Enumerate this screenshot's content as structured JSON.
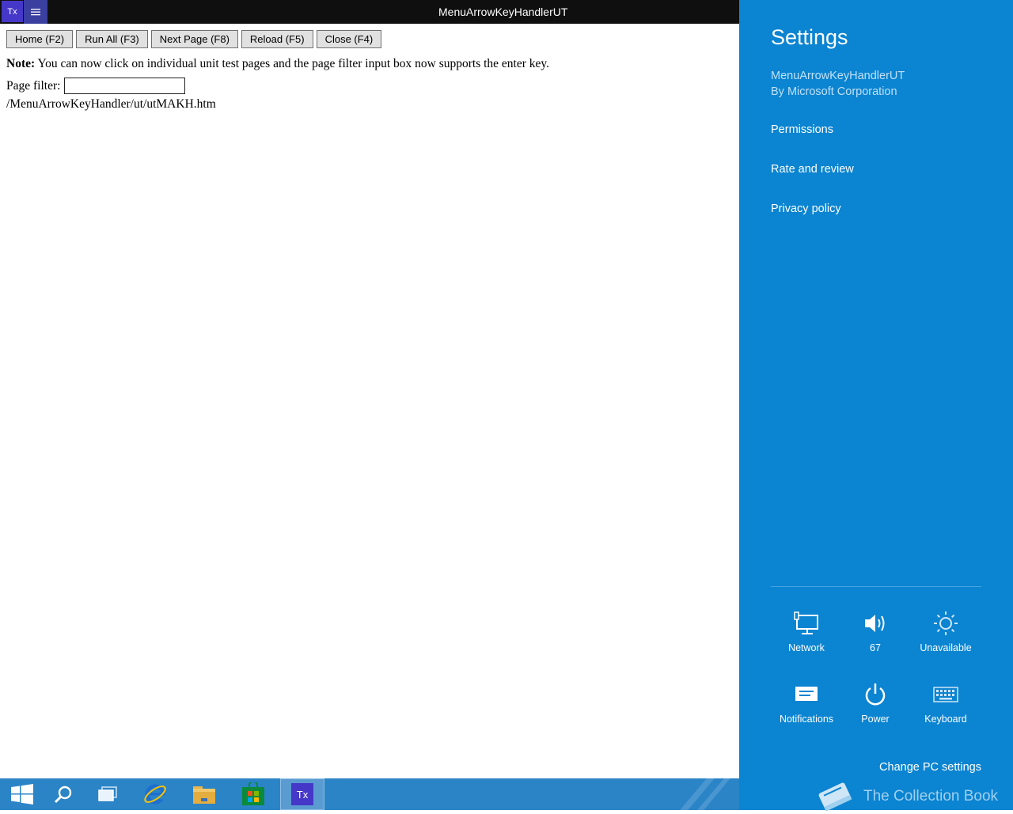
{
  "titlebar": {
    "app_icon_text": "Tx",
    "title": "MenuArrowKeyHandlerUT"
  },
  "toolbar": {
    "buttons": [
      {
        "label": "Home (F2)"
      },
      {
        "label": "Run All (F3)"
      },
      {
        "label": "Next Page (F8)"
      },
      {
        "label": "Reload (F5)"
      },
      {
        "label": "Close (F4)"
      }
    ]
  },
  "note": {
    "label": "Note:",
    "text": " You can now click on individual unit test pages and the page filter input box now supports the enter key."
  },
  "filter": {
    "label": "Page filter:",
    "value": ""
  },
  "test_page_path": "/MenuArrowKeyHandler/ut/utMAKH.htm",
  "taskbar": {
    "items": [
      "start-icon",
      "search-icon",
      "task-view-icon",
      "internet-explorer-icon",
      "file-explorer-icon",
      "store-icon",
      "tx-app-icon"
    ],
    "active_app_text": "Tx"
  },
  "settings": {
    "title": "Settings",
    "app_name": "MenuArrowKeyHandlerUT",
    "publisher": "By Microsoft Corporation",
    "links": [
      "Permissions",
      "Rate and review",
      "Privacy policy"
    ],
    "quick": {
      "network": "Network",
      "volume": "67",
      "brightness": "Unavailable",
      "notifications": "Notifications",
      "power": "Power",
      "keyboard": "Keyboard"
    },
    "change_pc_settings": "Change PC settings"
  },
  "watermark": "The Collection Book",
  "colors": {
    "charm_bg": "#0b84d1",
    "taskbar_bg": "#2a84c6",
    "titlebar_bg": "#0f0f0f",
    "app_icon_bg": "#4538c8"
  }
}
